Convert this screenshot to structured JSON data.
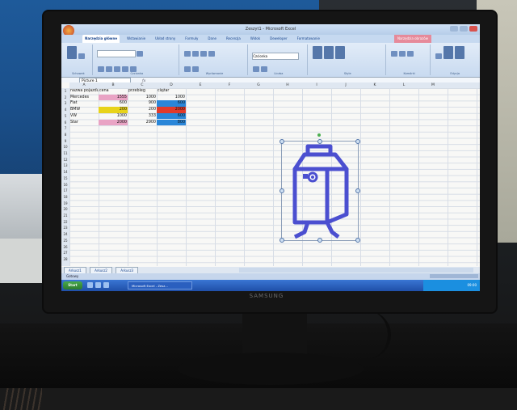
{
  "window": {
    "title": "Zeszyt1 - Microsoft Excel",
    "context_tab": "Narzędzia obrazów"
  },
  "ribbon_tabs": [
    "Narzędzia główne",
    "Wstawianie",
    "Układ strony",
    "Formuły",
    "Dane",
    "Recenzja",
    "Widok",
    "Deweloper",
    "Formatowanie"
  ],
  "ribbon": {
    "font_name": "Czcionka",
    "groups": [
      "Schowek",
      "Czcionka",
      "Wyrównanie",
      "Liczba",
      "Style",
      "Komórki",
      "Edycja"
    ]
  },
  "formula_bar": {
    "name_box": "Picture 1",
    "fx": "fx"
  },
  "sheet": {
    "columns": [
      "A",
      "B",
      "C",
      "D",
      "E",
      "F",
      "G",
      "H",
      "I",
      "J",
      "K",
      "L",
      "M"
    ],
    "rows": [
      "1",
      "2",
      "3",
      "4",
      "5",
      "6",
      "7",
      "8",
      "9",
      "10",
      "11",
      "12",
      "13",
      "14",
      "15",
      "16",
      "17",
      "18",
      "19",
      "20",
      "21",
      "22",
      "23",
      "24",
      "25",
      "26",
      "27",
      "28"
    ],
    "headers": [
      "nazwa pojazdu",
      "cena",
      "przebieg",
      "ciężar"
    ],
    "data": [
      [
        "Mercedes",
        "1555",
        "1000",
        "1000"
      ],
      [
        "Fiat",
        "600",
        "900",
        "600"
      ],
      [
        "BMW",
        "200",
        "200",
        "2000"
      ],
      [
        "VW",
        "1000",
        "333",
        "600"
      ],
      [
        "Star",
        "2000",
        "2900",
        "800"
      ]
    ]
  },
  "colors": {
    "pink": "#e9a3c4",
    "yellow": "#e8d31a",
    "red": "#e23a2a",
    "blue": "#2a86d8",
    "shape_stroke": "#4b4fd0"
  },
  "sheet_tabs": [
    "Arkusz1",
    "Arkusz2",
    "Arkusz3"
  ],
  "status": {
    "ready": "Gotowy",
    "zoom": "100%"
  },
  "taskbar": {
    "start": "Start",
    "task": "Microsoft Excel - Zesz...",
    "clock": "09:00"
  },
  "monitor": {
    "brand": "SAMSUNG"
  },
  "drawing": {
    "subject": "milk-carton-character-icon"
  }
}
